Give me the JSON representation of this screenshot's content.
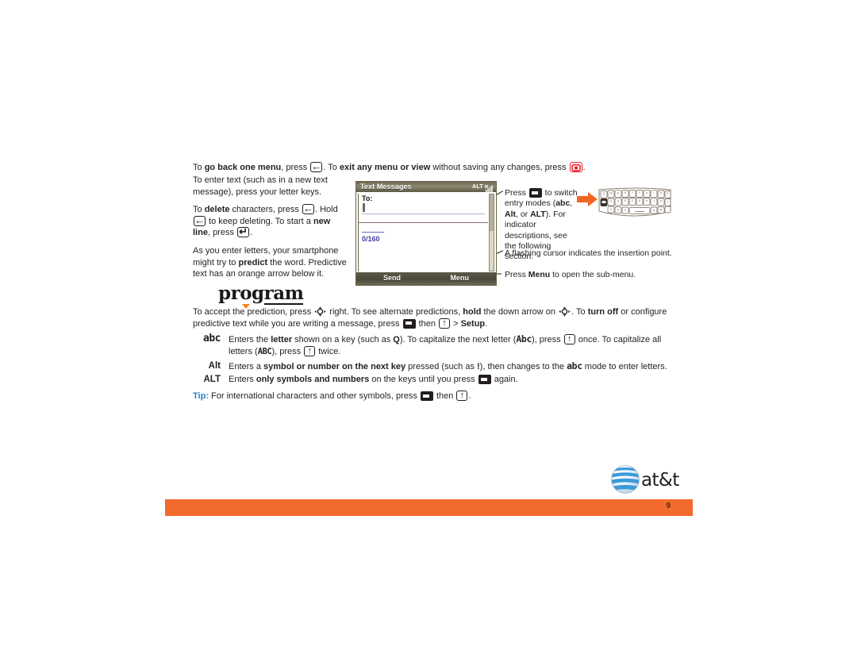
{
  "document": {
    "page_number": "9",
    "brand": "at&t",
    "brand_logo": "att-globe-logo",
    "footer_color": "#f26b2d"
  },
  "intro": {
    "p1": "To ",
    "b1": "go back one menu",
    "p2": ", press ",
    "icon1": "back-key-icon",
    "p3": ". To ",
    "b2": "exit any menu or view",
    "p4": " without saving any changes, press ",
    "icon2": "end-call-key-icon",
    "p5": "."
  },
  "left_column": {
    "para1": {
      "t1": "To enter text (such as in a new text message), press your letter keys."
    },
    "para2": {
      "t1": "To ",
      "b1": "delete",
      "t2": " characters, press ",
      "icon1": "back-key-icon",
      "t3": ". Hold ",
      "icon2": "back-key-icon",
      "t4": " to keep deleting. To start a ",
      "b2": "new line",
      "t5": ", press ",
      "icon3": "enter-key-icon",
      "t6": "."
    },
    "para3": {
      "t1": "As you enter letters, your smartphone might try to ",
      "b1": "predict",
      "t2": " the word. Predictive text has an orange arrow below it."
    }
  },
  "program_sample": {
    "prefix": "prog",
    "highlight": "ram",
    "arrow_color": "#f5821f"
  },
  "phone_screen": {
    "title": "Text Messages",
    "status_mode": "ALT",
    "status_signal_icon": "signal-strength-icon",
    "to_label": "To:",
    "char_count": "0/160",
    "softkey_left": "Send",
    "softkey_right": "Menu",
    "cursor_icon": "text-cursor"
  },
  "callouts": [
    {
      "id": "entry-modes",
      "t1": "Press ",
      "icon": "alt-key-icon",
      "t2": " to switch entry modes (",
      "b1": "abc",
      "t3": ", ",
      "b2": "Alt",
      "t4": ", or ",
      "b3": "ALT",
      "t5": "). For indicator descriptions, see the following section."
    },
    {
      "id": "flashing-cursor",
      "text": "A flashing cursor indicates the insertion point."
    },
    {
      "id": "sub-menu",
      "t1": "Press ",
      "b1": "Menu",
      "t2": " to open the sub-menu."
    }
  ],
  "keyboard_illustration": {
    "name": "qwerty-keyboard-illustration",
    "arrow_name": "orange-pointer-arrow",
    "arrow_color": "#f26522",
    "rows": [
      [
        "Q\n1",
        "W\n2",
        "E\n3",
        "R\n4",
        "T\n5",
        "Y\n6",
        "U\n7",
        "I\n8",
        "O\n9",
        "P\n0"
      ],
      [
        "A",
        "S",
        "D",
        "F",
        "G",
        "H",
        "J",
        "K",
        "L"
      ],
      [
        "Z",
        "X",
        "C",
        "V",
        "B",
        "N",
        "M"
      ]
    ]
  },
  "accept_paragraph": {
    "t1": "To accept the prediction, press ",
    "icon1": "nav-pad-icon",
    "t2": " right. To see alternate predictions, ",
    "b1": "hold",
    "t3": " the down arrow on ",
    "icon2": "nav-pad-icon",
    "t4": ". To ",
    "b2": "turn off",
    "t5": " or configure predictive text while you are writing a message, press ",
    "icon3": "alt-key-icon",
    "t6": " then ",
    "icon4": "shift-key-icon",
    "t7": " > ",
    "b3": "Setup",
    "t8": "."
  },
  "definitions": [
    {
      "term": "abc",
      "term_style": "mode-glyph",
      "t1": "Enters the ",
      "b1": "letter",
      "t2": " shown on a key (such as ",
      "b2": "Q",
      "t3": "). To capitalize the next letter (",
      "g1": "Abc",
      "t4": "), press ",
      "icon1": "shift-key-icon",
      "t5": " once. To capitalize all letters (",
      "g2": "ABC",
      "t6": "), press ",
      "icon2": "shift-key-icon",
      "t7": " twice."
    },
    {
      "term": "Alt",
      "term_style": "bold",
      "t1": "Enters a ",
      "b1": "symbol or number on the next key",
      "t2": " pressed (such as ",
      "b2": "!",
      "t3": "), then changes to the ",
      "g1": "abc",
      "t4": " mode to enter letters."
    },
    {
      "term": "ALT",
      "term_style": "bold",
      "t1": "Enters ",
      "b1": "only symbols and numbers",
      "t2": " on the keys until you press ",
      "icon1": "alt-key-icon",
      "t3": " again."
    }
  ],
  "tip": {
    "label": "Tip:",
    "t1": " For international characters and other symbols, press ",
    "icon1": "alt-key-icon",
    "t2": " then ",
    "icon2": "shift-key-icon",
    "t3": "."
  }
}
